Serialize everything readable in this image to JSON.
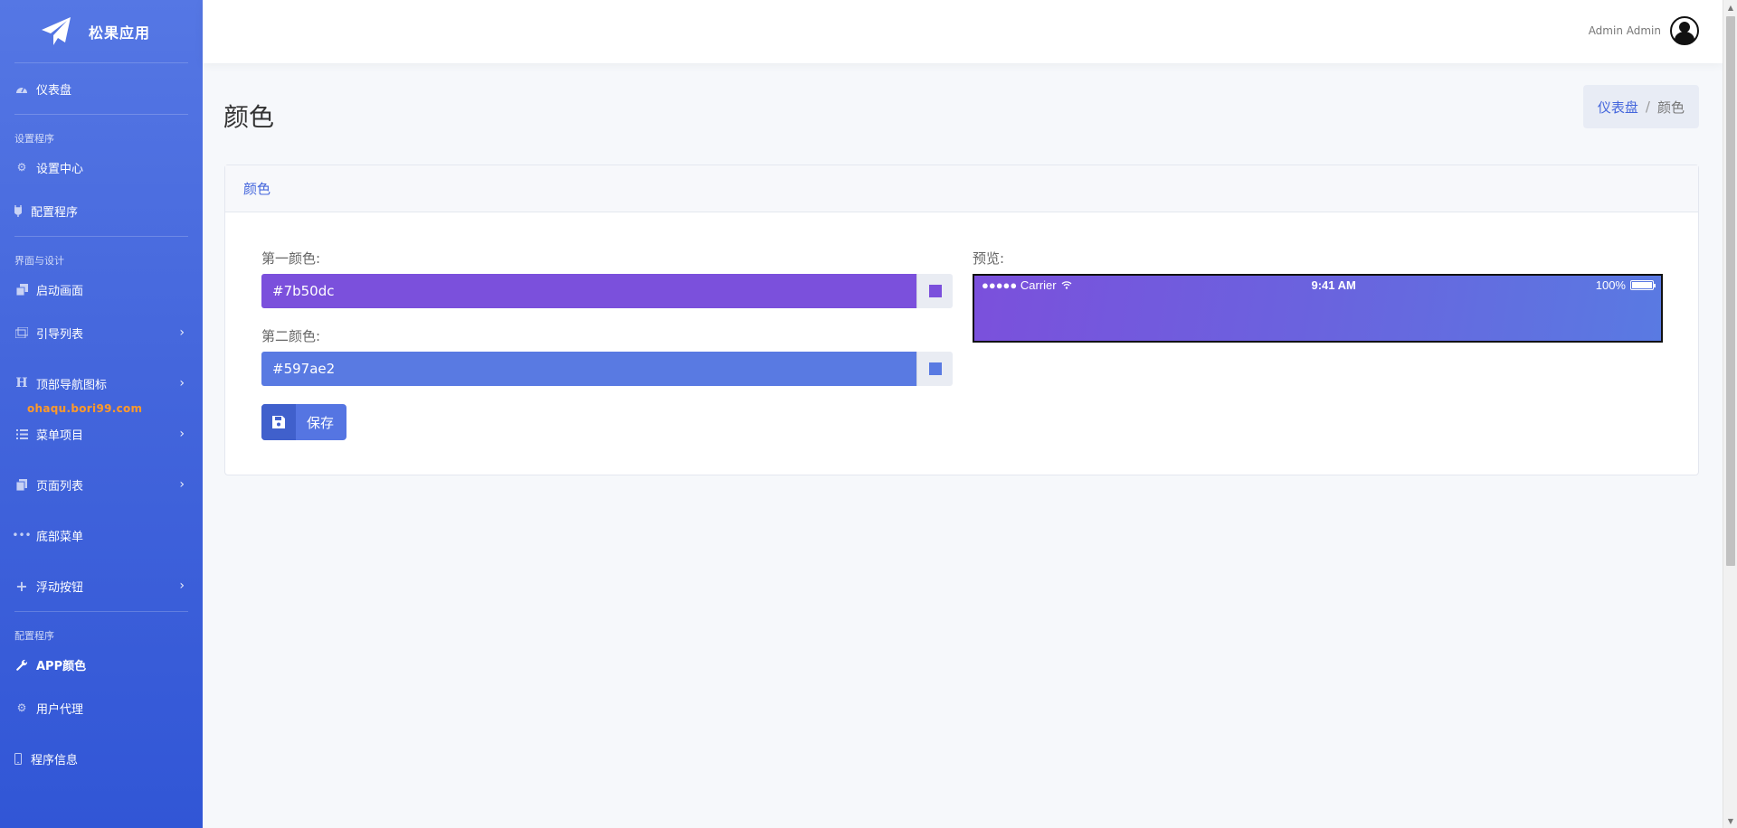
{
  "sidebar": {
    "brand_title": "松果应用",
    "watermark": "ohaqu.bori99.com",
    "sections": {
      "setup": "设置程序",
      "ui_design": "界面与设计",
      "configure": "配置程序"
    },
    "items": {
      "dashboard": "仪表盘",
      "settings_center": "设置中心",
      "config_app": "配置程序",
      "launch_screen": "启动画面",
      "guide_list": "引导列表",
      "top_nav_icons": "顶部导航图标",
      "menu_items": "菜单项目",
      "page_list": "页面列表",
      "bottom_menu": "底部菜单",
      "float_button": "浮动按钮",
      "app_colors": "APP颜色",
      "user_agent": "用户代理",
      "app_info": "程序信息"
    }
  },
  "header": {
    "username": "Admin Admin"
  },
  "page": {
    "title": "颜色",
    "breadcrumb": {
      "home": "仪表盘",
      "separator": "/",
      "current": "颜色"
    }
  },
  "card": {
    "title": "颜色",
    "first_color_label": "第一颜色:",
    "first_color_value": "#7b50dc",
    "second_color_label": "第二颜色:",
    "second_color_value": "#597ae2",
    "save_label": "保存",
    "preview_label": "预览:",
    "preview": {
      "carrier": "●●●●● Carrier",
      "time": "9:41 AM",
      "battery": "100%"
    }
  },
  "colors": {
    "accent": "#4466dc",
    "first": "#7b50dc",
    "second": "#597ae2"
  }
}
